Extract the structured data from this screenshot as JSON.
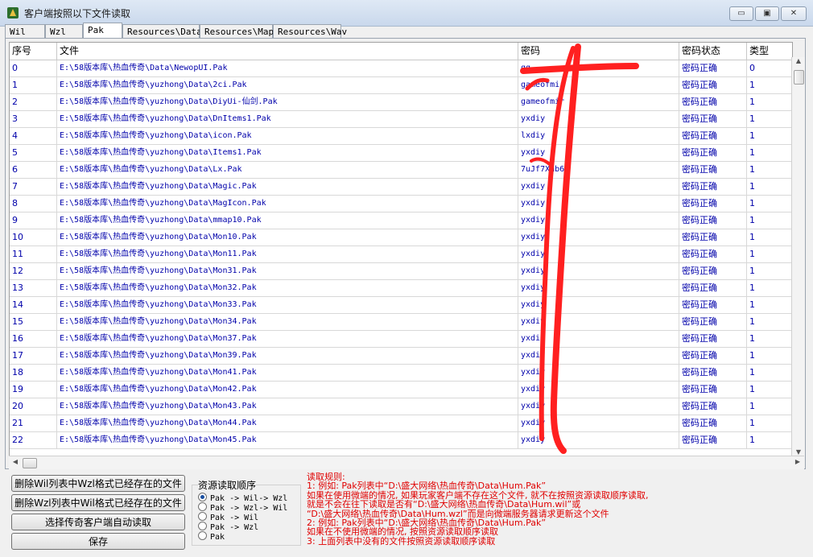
{
  "window": {
    "title": "客户端按照以下文件读取",
    "min_label": "▭",
    "max_label": "▣",
    "close_label": "✕"
  },
  "tabs": [
    "Wil",
    "Wzl",
    "Pak",
    "Resources\\Data",
    "Resources\\Map",
    "Resources\\Wav"
  ],
  "table": {
    "columns": [
      "序号",
      "文件",
      "密码",
      "密码状态",
      "类型"
    ],
    "rows": [
      [
        "0",
        "E:\\58版本库\\热血传奇\\Data\\NewopUI.Pak",
        "qq",
        "密码正确",
        "0"
      ],
      [
        "1",
        "E:\\58版本库\\热血传奇\\yuzhong\\Data\\2ci.Pak",
        "gameofmir",
        "密码正确",
        "1"
      ],
      [
        "2",
        "E:\\58版本库\\热血传奇\\yuzhong\\Data\\DiyUi-仙剑.Pak",
        "gameofmir",
        "密码正确",
        "1"
      ],
      [
        "3",
        "E:\\58版本库\\热血传奇\\yuzhong\\Data\\DnItems1.Pak",
        "yxdiy",
        "密码正确",
        "1"
      ],
      [
        "4",
        "E:\\58版本库\\热血传奇\\yuzhong\\Data\\icon.Pak",
        "lxdiy",
        "密码正确",
        "1"
      ],
      [
        "5",
        "E:\\58版本库\\热血传奇\\yuzhong\\Data\\Items1.Pak",
        "yxdiy",
        "密码正确",
        "1"
      ],
      [
        "6",
        "E:\\58版本库\\热血传奇\\yuzhong\\Data\\Lx.Pak",
        "7uJf7Xhb6Q",
        "密码正确",
        "1"
      ],
      [
        "7",
        "E:\\58版本库\\热血传奇\\yuzhong\\Data\\Magic.Pak",
        "yxdiy",
        "密码正确",
        "1"
      ],
      [
        "8",
        "E:\\58版本库\\热血传奇\\yuzhong\\Data\\MagIcon.Pak",
        "yxdiy",
        "密码正确",
        "1"
      ],
      [
        "9",
        "E:\\58版本库\\热血传奇\\yuzhong\\Data\\mmap10.Pak",
        "yxdiy",
        "密码正确",
        "1"
      ],
      [
        "10",
        "E:\\58版本库\\热血传奇\\yuzhong\\Data\\Mon10.Pak",
        "yxdiy",
        "密码正确",
        "1"
      ],
      [
        "11",
        "E:\\58版本库\\热血传奇\\yuzhong\\Data\\Mon11.Pak",
        "yxdiy",
        "密码正确",
        "1"
      ],
      [
        "12",
        "E:\\58版本库\\热血传奇\\yuzhong\\Data\\Mon31.Pak",
        "yxdiy",
        "密码正确",
        "1"
      ],
      [
        "13",
        "E:\\58版本库\\热血传奇\\yuzhong\\Data\\Mon32.Pak",
        "yxdiy",
        "密码正确",
        "1"
      ],
      [
        "14",
        "E:\\58版本库\\热血传奇\\yuzhong\\Data\\Mon33.Pak",
        "yxdiy",
        "密码正确",
        "1"
      ],
      [
        "15",
        "E:\\58版本库\\热血传奇\\yuzhong\\Data\\Mon34.Pak",
        "yxdiy",
        "密码正确",
        "1"
      ],
      [
        "16",
        "E:\\58版本库\\热血传奇\\yuzhong\\Data\\Mon37.Pak",
        "yxdiy",
        "密码正确",
        "1"
      ],
      [
        "17",
        "E:\\58版本库\\热血传奇\\yuzhong\\Data\\Mon39.Pak",
        "yxdiy",
        "密码正确",
        "1"
      ],
      [
        "18",
        "E:\\58版本库\\热血传奇\\yuzhong\\Data\\Mon41.Pak",
        "yxdiy",
        "密码正确",
        "1"
      ],
      [
        "19",
        "E:\\58版本库\\热血传奇\\yuzhong\\Data\\Mon42.Pak",
        "yxdiy",
        "密码正确",
        "1"
      ],
      [
        "20",
        "E:\\58版本库\\热血传奇\\yuzhong\\Data\\Mon43.Pak",
        "yxdiy",
        "密码正确",
        "1"
      ],
      [
        "21",
        "E:\\58版本库\\热血传奇\\yuzhong\\Data\\Mon44.Pak",
        "yxdiy",
        "密码正确",
        "1"
      ],
      [
        "22",
        "E:\\58版本库\\热血传奇\\yuzhong\\Data\\Mon45.Pak",
        "yxdiy",
        "密码正确",
        "1"
      ]
    ]
  },
  "buttons": {
    "del_wil": "删除Wil列表中Wzl格式已经存在的文件",
    "del_wzl": "删除Wzl列表中Wil格式已经存在的文件",
    "auto_read": "选择传奇客户端自动读取",
    "save": "保存"
  },
  "order_group": {
    "title": "资源读取顺序",
    "options": [
      "Pak -> Wil-> Wzl",
      "Pak -> Wzl-> Wil",
      "Pak -> Wil",
      "Pak -> Wzl",
      "Pak"
    ],
    "selected_index": 0
  },
  "rules": [
    "读取规则:",
    "1: 例如: Pak列表中“D:\\盛大网络\\热血传奇\\Data\\Hum.Pak”",
    "    如果在使用微端的情况, 如果玩家客户端不存在这个文件, 就不在按照资源读取顺序读取,",
    "    就是不会在往下读取是否有“D:\\盛大网络\\热血传奇\\Data\\Hum.wil”或",
    "    “D:\\盛大网络\\热血传奇\\Data\\Hum.wzl”而是向微端服务器请求更新这个文件",
    "2: 例如: Pak列表中“D:\\盛大网络\\热血传奇\\Data\\Hum.Pak”",
    "    如果在不使用微端的情况, 按照资源读取顺序读取",
    "3: 上面列表中没有的文件按照资源读取顺序读取"
  ],
  "colors": {
    "link_blue": "#0000aa",
    "rule_red": "#e00000",
    "scribble_red": "#ff2020"
  }
}
